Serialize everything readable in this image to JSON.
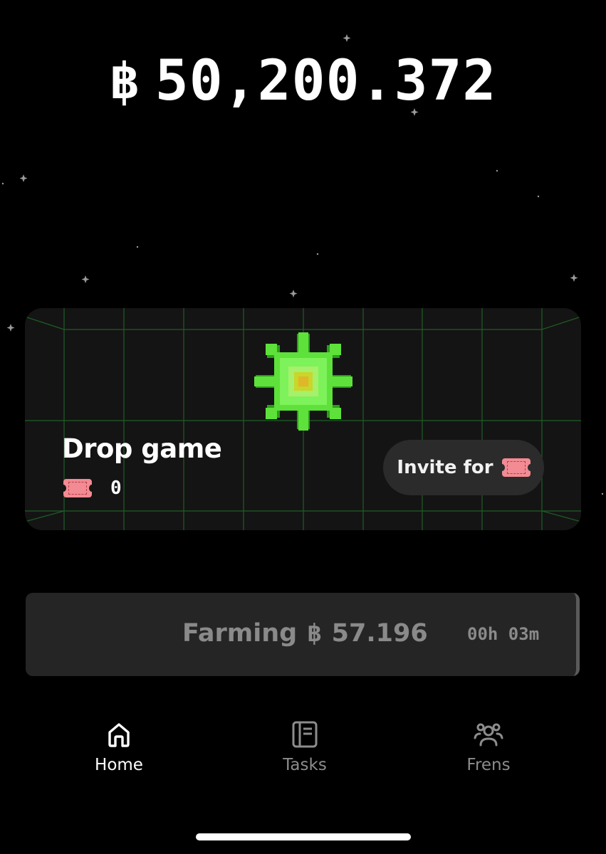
{
  "header": {
    "currency_symbol": "฿",
    "balance": "50,200.372"
  },
  "drop_game": {
    "title": "Drop game",
    "ticket_count": "0",
    "ticket_icon": "ticket-icon",
    "clover_icon": "pixel-clover-icon",
    "accent_color": "#4cd137",
    "invite_label": "Invite for"
  },
  "farming": {
    "label": "Farming",
    "currency_symbol": "฿",
    "amount": "57.196",
    "timer": "00h 03m"
  },
  "tabs": [
    {
      "label": "Home",
      "icon": "home-icon",
      "active": true
    },
    {
      "label": "Tasks",
      "icon": "tasks-icon",
      "active": false
    },
    {
      "label": "Frens",
      "icon": "frens-icon",
      "active": false
    }
  ]
}
